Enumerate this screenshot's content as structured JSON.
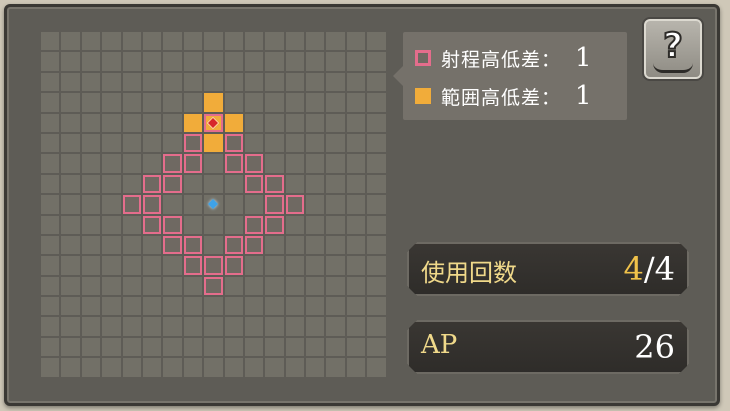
{
  "legend": {
    "range_height_label": "射程高低差：",
    "range_height_value": "1",
    "area_height_label": "範囲高低差：",
    "area_height_value": "1"
  },
  "help_button": {
    "glyph": "?",
    "icon": "help-book-icon"
  },
  "uses": {
    "label": "使用回数",
    "current": "4",
    "separator": "/",
    "max": "4"
  },
  "ap": {
    "label": "AP",
    "value": "26"
  },
  "colors": {
    "range_tile": "#e46d8c",
    "area_tile": "#f1ac3a",
    "player_marker": "#3ea2e8",
    "target_marker": "#d7262b",
    "stat_label": "#f0d98a"
  },
  "grid": {
    "columns": 17,
    "rows": 17,
    "range_cells": [
      [
        4,
        8
      ],
      [
        5,
        7
      ],
      [
        5,
        9
      ],
      [
        6,
        6
      ],
      [
        6,
        7
      ],
      [
        6,
        9
      ],
      [
        6,
        10
      ],
      [
        7,
        5
      ],
      [
        7,
        6
      ],
      [
        7,
        10
      ],
      [
        7,
        11
      ],
      [
        8,
        4
      ],
      [
        8,
        5
      ],
      [
        8,
        11
      ],
      [
        8,
        12
      ],
      [
        9,
        5
      ],
      [
        9,
        6
      ],
      [
        9,
        10
      ],
      [
        9,
        11
      ],
      [
        10,
        6
      ],
      [
        10,
        7
      ],
      [
        10,
        9
      ],
      [
        10,
        10
      ],
      [
        11,
        7
      ],
      [
        11,
        8
      ],
      [
        11,
        9
      ],
      [
        12,
        8
      ]
    ],
    "area_cells": [
      [
        3,
        8
      ],
      [
        4,
        7
      ],
      [
        4,
        9
      ],
      [
        5,
        8
      ]
    ],
    "player_cell": [
      8,
      8
    ],
    "target_cell": [
      4,
      8
    ]
  }
}
